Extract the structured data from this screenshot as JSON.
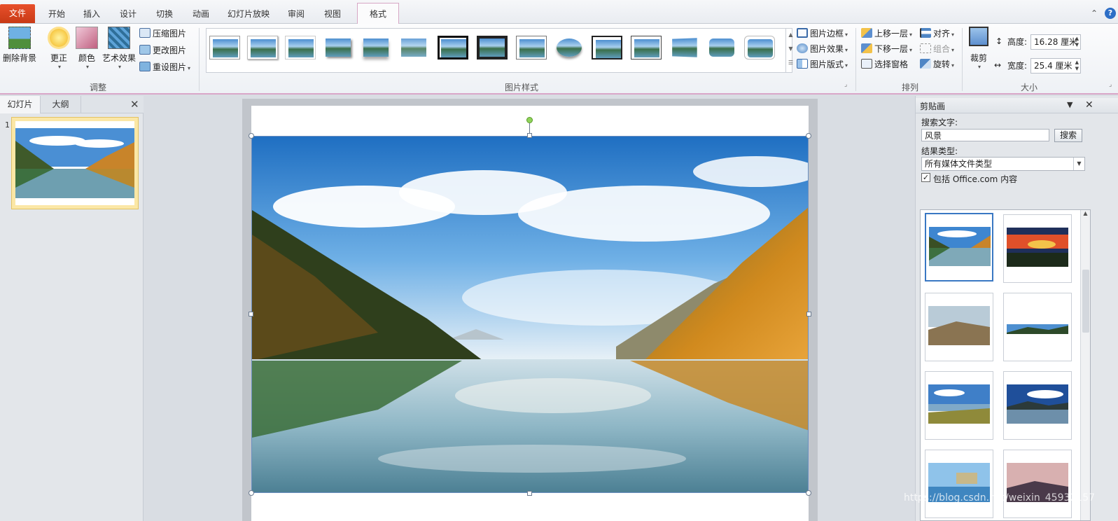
{
  "tabs": {
    "file": "文件",
    "items": [
      "开始",
      "插入",
      "设计",
      "切换",
      "动画",
      "幻灯片放映",
      "审阅",
      "视图"
    ],
    "active": "格式"
  },
  "ribbon": {
    "adjust": {
      "remove_bg": "删除背景",
      "corrections": "更正",
      "color": "颜色",
      "artistic": "艺术效果",
      "compress": "压缩图片",
      "change": "更改图片",
      "reset": "重设图片",
      "group_label": "调整"
    },
    "styles": {
      "group_label": "图片样式",
      "border": "图片边框",
      "effects": "图片效果",
      "layout": "图片版式"
    },
    "arrange": {
      "group_label": "排列",
      "bring_forward": "上移一层",
      "send_backward": "下移一层",
      "selection_pane": "选择窗格",
      "align": "对齐",
      "group": "组合",
      "rotate": "旋转"
    },
    "size": {
      "group_label": "大小",
      "crop": "裁剪",
      "height_label": "高度:",
      "height_value": "16.28 厘米",
      "width_label": "宽度:",
      "width_value": "25.4 厘米"
    }
  },
  "left_pane": {
    "tab_slides": "幻灯片",
    "tab_outline": "大纲",
    "slide_number": "1"
  },
  "clipart": {
    "title": "剪贴画",
    "search_label": "搜索文字:",
    "search_value": "风景",
    "search_button": "搜索",
    "results_label": "结果类型:",
    "results_type": "所有媒体文件类型",
    "include_label": "包括 Office.com 内容",
    "include_checked": true
  },
  "watermark": "https://blog.csdn.net/weixin_45932157",
  "colors": {
    "file_tab": "#d6451c",
    "format_tab_border": "#d7a7c5",
    "selection": "#3a78c3"
  }
}
